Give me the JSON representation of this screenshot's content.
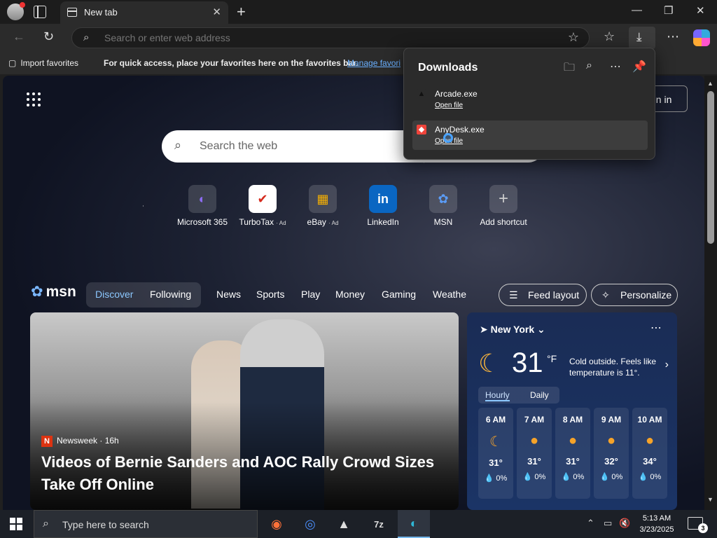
{
  "tab": {
    "title": "New tab"
  },
  "toolbar": {
    "address_placeholder": "Search or enter web address"
  },
  "favorites_bar": {
    "import_label": "Import favorites",
    "message": "For quick access, place your favorites here on the favorites bar.",
    "manage_link": "Manage favori"
  },
  "page": {
    "sign_in": "gn in",
    "search_placeholder": "Search the web",
    "shortcuts": [
      {
        "label": "Microsoft 365",
        "ad": "",
        "icon": "◐",
        "color": "#8b6cf0"
      },
      {
        "label": "TurboTax",
        "ad": "· Ad",
        "icon": "✔",
        "color": "#d52b1e"
      },
      {
        "label": "eBay",
        "ad": "· Ad",
        "icon": "▦",
        "color": "#e53238"
      },
      {
        "label": "LinkedIn",
        "ad": "",
        "icon": "in",
        "color": "#0a66c2"
      },
      {
        "label": "MSN",
        "ad": "",
        "icon": "✿",
        "color": "#5b9cf6"
      },
      {
        "label": "Add shortcut",
        "ad": "",
        "icon": "+",
        "color": "#888888"
      }
    ]
  },
  "msn": {
    "logo": "msn",
    "tabs": [
      "Discover",
      "Following"
    ],
    "nav": [
      "News",
      "Sports",
      "Play",
      "Money",
      "Gaming",
      "Weathe"
    ],
    "feed_layout": "Feed layout",
    "personalize": "Personalize"
  },
  "hero": {
    "source": "Newsweek",
    "age": "· 16h",
    "headline": "Videos of Bernie Sanders and AOC Rally Crowd Sizes Take Off Online"
  },
  "weather": {
    "location": "New York",
    "temp": "31",
    "unit": "°F",
    "note": "Cold outside. Feels like temperature is 11°.",
    "tabs": [
      "Hourly",
      "Daily"
    ],
    "hours": [
      {
        "time": "6 AM",
        "temp": "31°",
        "precip": "0%",
        "icon": "moon"
      },
      {
        "time": "7 AM",
        "temp": "31°",
        "precip": "0%",
        "icon": "sun"
      },
      {
        "time": "8 AM",
        "temp": "31°",
        "precip": "0%",
        "icon": "sun"
      },
      {
        "time": "9 AM",
        "temp": "32°",
        "precip": "0%",
        "icon": "sun"
      },
      {
        "time": "10 AM",
        "temp": "34°",
        "precip": "0%",
        "icon": "sun"
      }
    ]
  },
  "downloads": {
    "title": "Downloads",
    "items": [
      {
        "name": "Arcade.exe",
        "action": "Open file"
      },
      {
        "name": "AnyDesk.exe",
        "action": "Open file"
      }
    ]
  },
  "taskbar": {
    "search_placeholder": "Type here to search",
    "time": "5:13 AM",
    "date": "3/23/2025",
    "notifications": "3"
  }
}
